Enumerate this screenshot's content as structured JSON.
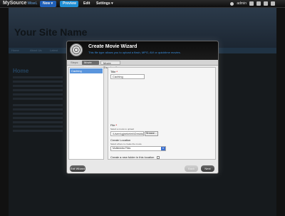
{
  "topbar": {
    "brand": "MySource",
    "brand_sub": "WiseL",
    "menu": {
      "new": "New ▾",
      "preview": "Preview",
      "edit": "Edit",
      "settings": "Settings ▾"
    },
    "user": "admin"
  },
  "site": {
    "name": "Your Site Name",
    "nav": [
      "Home",
      "About Us",
      "Latest"
    ],
    "home_heading": "Home"
  },
  "wizard": {
    "title": "Create Movie Wizard",
    "subtitle": "This file type allows you to upload a flash, MPG, AVI or quicktime movies.",
    "steps_label": "Steps:",
    "steps": [
      "Movie Details",
      "Movie Thumbnail"
    ],
    "side_items": [
      "Caching"
    ],
    "form": {
      "title_label": "Title",
      "title_value": "Caching",
      "file_label": "File",
      "file_hint": "Select a movie to upload",
      "file_value": "\\Users\\gjnekelek\\Desktop",
      "browse_label": "Browse...",
      "location_label": "Create Location",
      "location_hint": "Select where to create the movie",
      "location_value": "Multimedia Files",
      "new_folder_label": "Create a new folder in this location"
    },
    "buttons": {
      "back": "Exit Wizard",
      "prev": "Back",
      "next": "Next"
    }
  }
}
